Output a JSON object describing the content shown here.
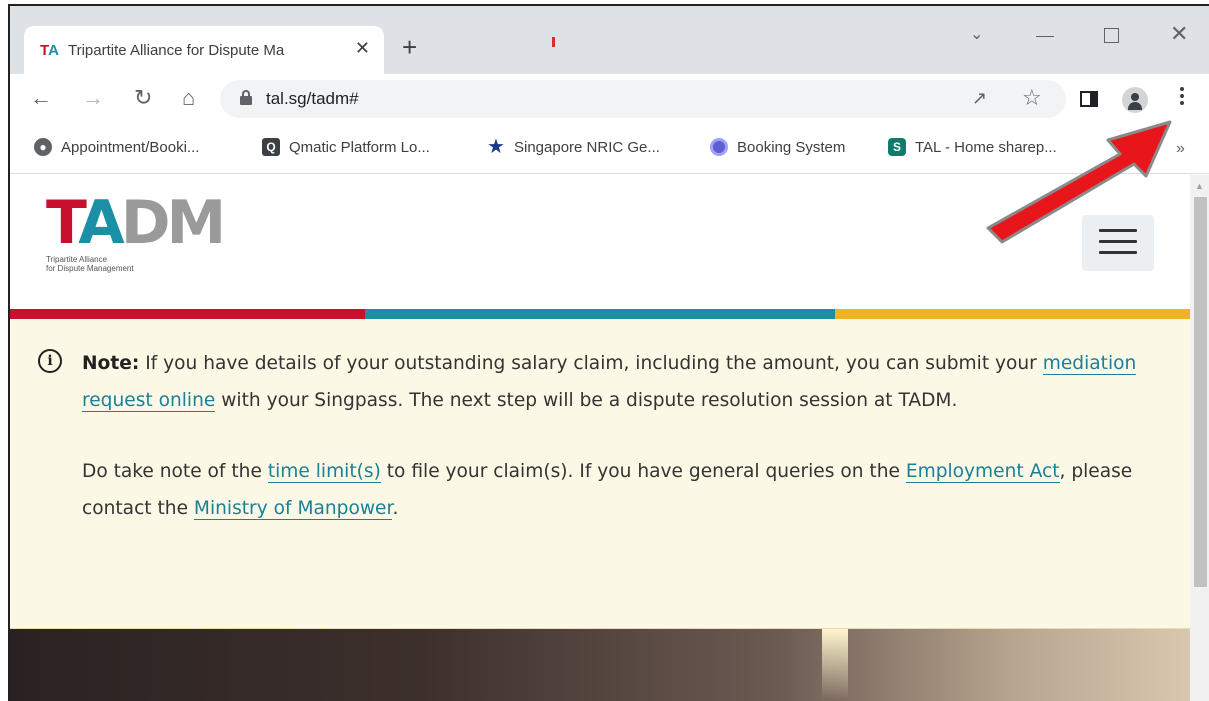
{
  "browser": {
    "tab_title": "Tripartite Alliance for Dispute Ma",
    "tab_favicon_left": "T",
    "tab_favicon_right": "A",
    "tab_close": "✕",
    "new_tab": "+",
    "url": "tal.sg/tadm#",
    "bookmarks": [
      {
        "label": "Appointment/Booki...",
        "icon": "globe-icon"
      },
      {
        "label": "Qmatic Platform Lo...",
        "icon": "qmatic-icon"
      },
      {
        "label": "Singapore NRIC Ge...",
        "icon": "star-icon"
      },
      {
        "label": "Booking System",
        "icon": "booking-icon"
      },
      {
        "label": "TAL - Home sharep...",
        "icon": "sharepoint-icon"
      }
    ],
    "bookmarks_overflow": "»",
    "annotation_color": "#e8161b"
  },
  "site": {
    "logo_t": "T",
    "logo_a": "A",
    "logo_dm": "DM",
    "logo_sub_line1": "Tripartite Alliance",
    "logo_sub_line2": "for Dispute Management",
    "brand_colors": {
      "red": "#c8102e",
      "teal": "#1a8fa6",
      "yellow": "#f0b323"
    }
  },
  "notice": {
    "note_label": "Note:",
    "p1_before": " If you have details of your outstanding salary claim, including the amount, you can submit your ",
    "p1_link": "mediation request online",
    "p1_after": " with your Singpass. The next step will be a dispute resolution session at TADM.",
    "p2_before": "Do take note of the ",
    "p2_link1": "time limit(s)",
    "p2_mid": " to file your claim(s). If you have general queries on the ",
    "p2_link2": "Employment Act",
    "p2_mid2": ", please contact the ",
    "p2_link3": "Ministry of Manpower",
    "p2_after": "."
  }
}
